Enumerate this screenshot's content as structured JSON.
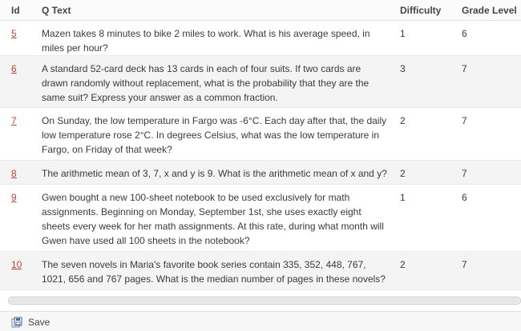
{
  "table": {
    "columns": [
      {
        "key": "id",
        "label": "Id"
      },
      {
        "key": "qtext",
        "label": "Q Text"
      },
      {
        "key": "difficulty",
        "label": "Difficulty"
      },
      {
        "key": "grade",
        "label": "Grade Level"
      }
    ],
    "rows": [
      {
        "id": "5",
        "qtext": "Mazen takes 8 minutes to bike 2 miles to work. What is his average speed, in miles per hour?",
        "difficulty": "1",
        "grade": "6"
      },
      {
        "id": "6",
        "qtext": "A standard 52-card deck has 13 cards in each of four suits. If two cards are drawn randomly without replacement, what is the probability that they are the same suit? Express your answer as a common fraction.",
        "difficulty": "3",
        "grade": "7"
      },
      {
        "id": "7",
        "qtext": "On Sunday, the low temperature in Fargo was -6°C. Each day after that, the daily low temperature rose 2°C. In degrees Celsius, what was the low temperature in Fargo, on Friday of that week?",
        "difficulty": "2",
        "grade": "7"
      },
      {
        "id": "8",
        "qtext": "The arithmetic mean of 3, 7, x and y is 9. What is the arithmetic mean of x and y?",
        "difficulty": "2",
        "grade": "7"
      },
      {
        "id": "9",
        "qtext": "Gwen bought a new 100-sheet notebook to be used exclusively for math assignments. Beginning on Monday, September 1st, she uses exactly eight sheets every week for her math assignments. At this rate, during what month will Gwen have used all 100 sheets in the notebook?",
        "difficulty": "1",
        "grade": "6"
      },
      {
        "id": "10",
        "qtext": "The seven novels in Maria's favorite book series contain 335, 352, 448, 767, 1021, 656 and 767 pages. What is the median number of pages in these novels?",
        "difficulty": "2",
        "grade": "7"
      }
    ]
  },
  "footer": {
    "save_label": "Save",
    "save_icon": "save-icon"
  },
  "colors": {
    "link": "#c8402f",
    "alt_row": "#f4f4f4"
  }
}
